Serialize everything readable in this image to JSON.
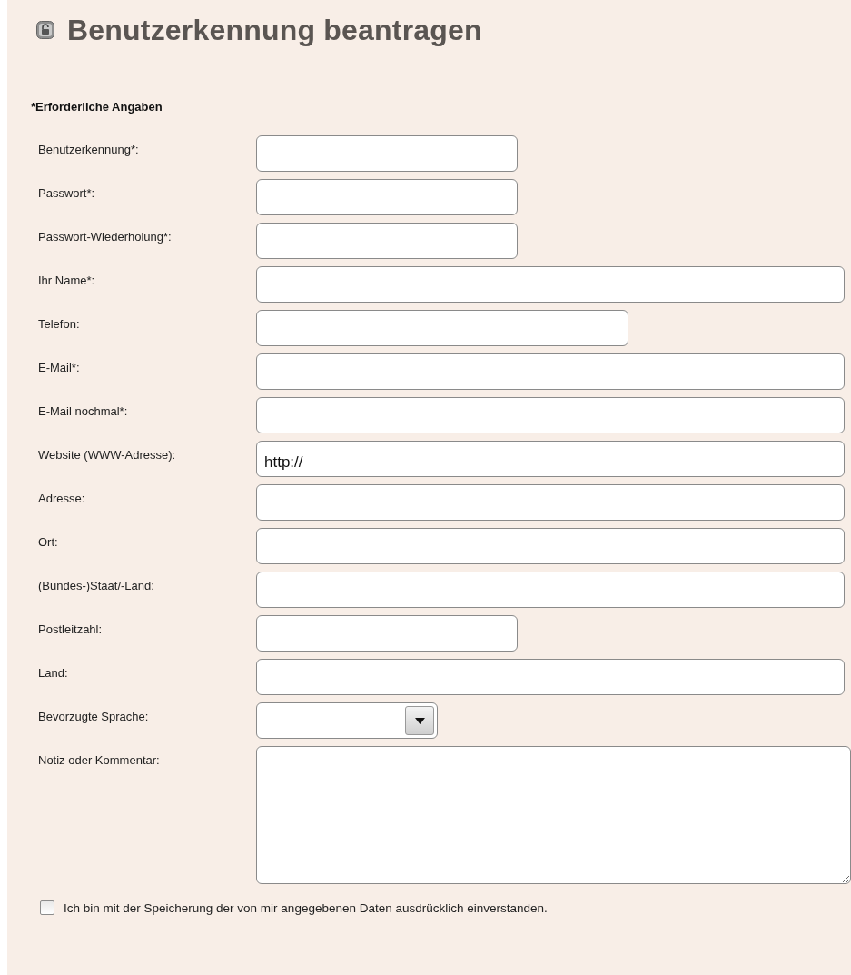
{
  "title": "Benutzerkennung beantragen",
  "required_note": "*Erforderliche Angaben",
  "fields": [
    {
      "label": "Benutzerkennung*:",
      "kind": "short"
    },
    {
      "label": "Passwort*:",
      "kind": "short"
    },
    {
      "label": "Passwort-Wiederholung*:",
      "kind": "short"
    },
    {
      "label": "Ihr Name*:",
      "kind": "long"
    },
    {
      "label": "Telefon:",
      "kind": "medium"
    },
    {
      "label": "E-Mail*:",
      "kind": "long"
    },
    {
      "label": "E-Mail nochmal*:",
      "kind": "long"
    },
    {
      "label": "Website (WWW-Adresse):",
      "kind": "long",
      "value": "http://"
    },
    {
      "label": "Adresse:",
      "kind": "long"
    },
    {
      "label": "Ort:",
      "kind": "long"
    },
    {
      "label": "(Bundes-)Staat/-Land:",
      "kind": "long"
    },
    {
      "label": "Postleitzahl:",
      "kind": "short"
    },
    {
      "label": "Land:",
      "kind": "long"
    },
    {
      "label": "Bevorzugte Sprache:",
      "kind": "select"
    },
    {
      "label": "Notiz oder Kommentar:",
      "kind": "textarea"
    }
  ],
  "consent": {
    "label": "Ich bin mit der Speicherung der von mir angegebenen Daten ausdrücklich einverstanden.",
    "checked": false
  }
}
